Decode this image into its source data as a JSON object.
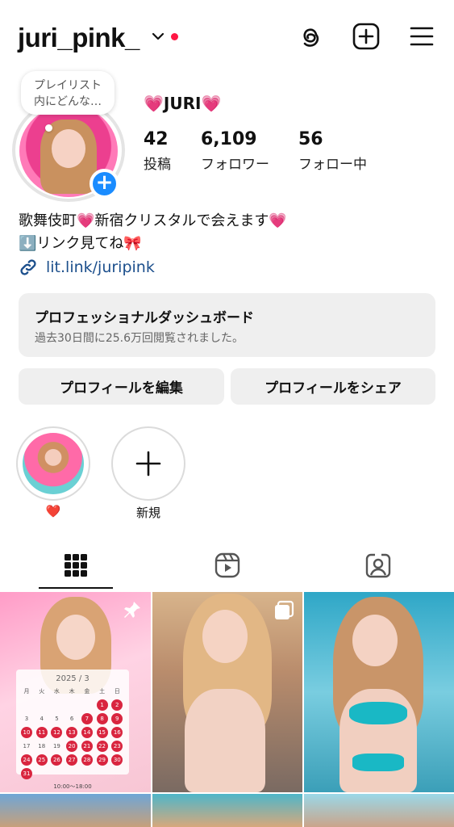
{
  "header": {
    "username": "juri_pink_",
    "notification_dot_color": "#ff1744"
  },
  "profile": {
    "note": "プレイリスト\n内にどんな…",
    "display_name": "JURI",
    "stats": [
      {
        "value": "42",
        "label": "投稿"
      },
      {
        "value": "6,109",
        "label": "フォロワー"
      },
      {
        "value": "56",
        "label": "フォロー中"
      }
    ],
    "bio_line1_a": "歌舞伎町",
    "bio_line1_b": "新宿クリスタルで会えます",
    "bio_line2": "リンク見てね",
    "link": "lit.link/juripink"
  },
  "dashboard": {
    "title": "プロフェッショナルダッシュボード",
    "subtitle": "過去30日間に25.6万回閲覧されました。"
  },
  "buttons": {
    "edit": "プロフィールを編集",
    "share": "プロフィールをシェア"
  },
  "highlights": [
    {
      "label": "❤️"
    },
    {
      "label": "新規"
    }
  ],
  "tabs": [
    "grid-icon",
    "reels-icon",
    "tagged-icon"
  ],
  "grid": {
    "calendar": {
      "month": "2025 / 3",
      "weekdays": [
        "月",
        "火",
        "水",
        "木",
        "金",
        "土",
        "日"
      ],
      "days": [
        "",
        "",
        "",
        "",
        "",
        "1",
        "2",
        "3",
        "4",
        "5",
        "6",
        "7",
        "8",
        "9",
        "10",
        "11",
        "12",
        "13",
        "14",
        "15",
        "16",
        "17",
        "18",
        "19",
        "20",
        "21",
        "22",
        "23",
        "24",
        "25",
        "26",
        "27",
        "28",
        "29",
        "30",
        "31"
      ],
      "highlighted": [
        "1",
        "2",
        "7",
        "8",
        "9",
        "10",
        "11",
        "12",
        "13",
        "14",
        "15",
        "16",
        "20",
        "21",
        "22",
        "23",
        "24",
        "25",
        "26",
        "27",
        "28",
        "29",
        "30",
        "31"
      ],
      "hours": "10:00〜18:00"
    }
  },
  "colors": {
    "accent_blue": "#1a8cff",
    "link_blue": "#1c4f8c",
    "heart_pink": "#ff3ca5"
  }
}
